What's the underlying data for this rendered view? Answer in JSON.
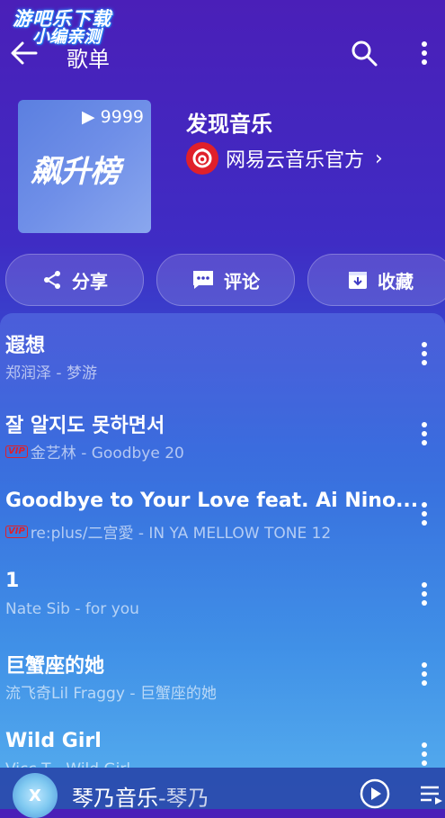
{
  "watermark": {
    "line1": "游吧乐下载",
    "line2": "小编亲测"
  },
  "header": {
    "title": "歌单"
  },
  "playlist": {
    "cover_plays": "9999",
    "cover_title": "飙升榜",
    "name": "发现音乐",
    "creator": "网易云音乐官方",
    "creator_chevron": "›"
  },
  "actions": {
    "share": "分享",
    "comment": "评论",
    "collect": "收藏"
  },
  "songs": [
    {
      "title": "遐想",
      "vip": false,
      "meta": "郑润泽 - 梦游"
    },
    {
      "title": "잘 알지도 못하면서",
      "vip": true,
      "meta": "金艺林 - Goodbye 20"
    },
    {
      "title": "Goodbye to Your Love feat. Ai Nino...",
      "vip": true,
      "meta": "re:plus/二宫愛 - IN YA MELLOW TONE 12"
    },
    {
      "title": "1",
      "vip": false,
      "meta": "Nate Sib - for you"
    },
    {
      "title": "巨蟹座的她",
      "vip": false,
      "meta": "流飞奇Lil Fraggy - 巨蟹座的她"
    },
    {
      "title": "Wild Girl",
      "vip": false,
      "meta": "Vicc T - Wild Girl"
    }
  ],
  "vip_label": "VIP",
  "player": {
    "title": "琴乃音乐",
    "artist": "-琴乃",
    "disc_letter": "X"
  },
  "colors": {
    "accent": "#e0202a",
    "bg_top": "#4a1fb8",
    "bg_bottom": "#5ab6f0"
  }
}
